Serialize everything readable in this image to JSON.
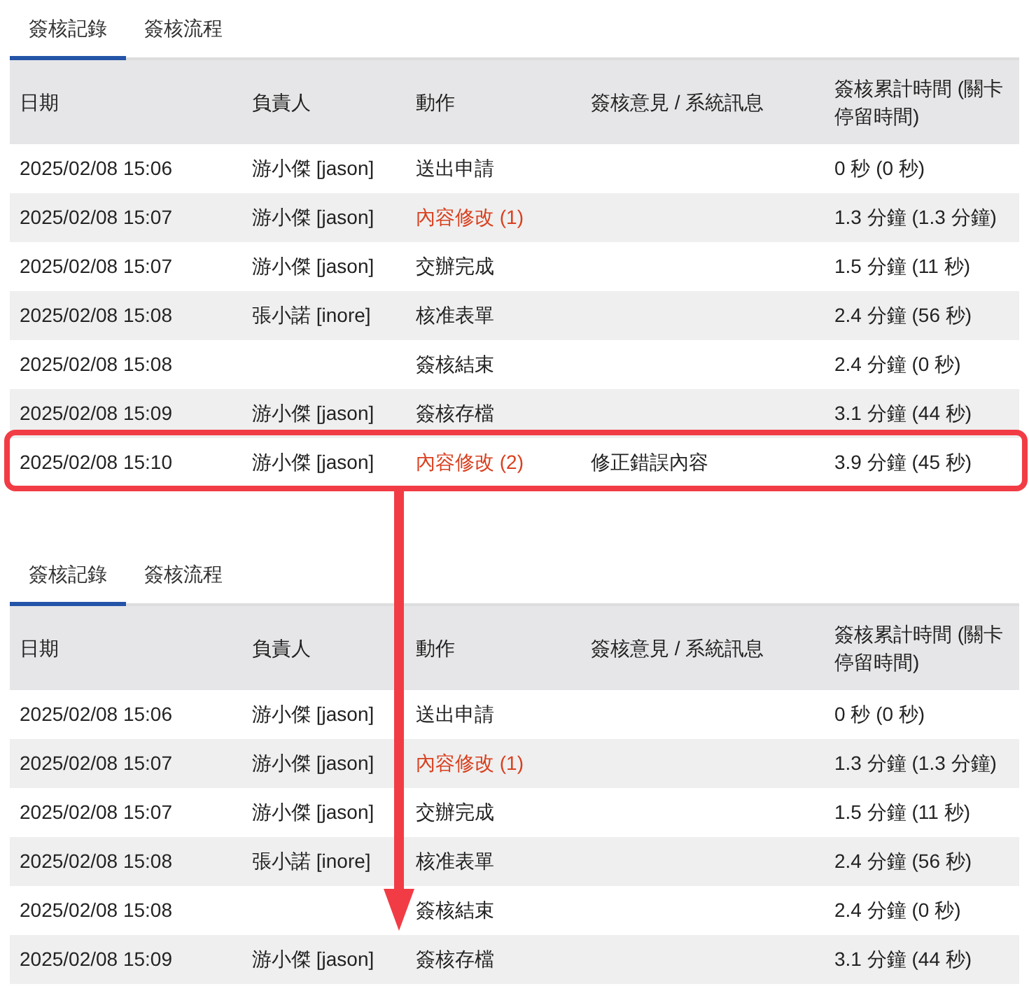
{
  "panels": [
    {
      "tabs": [
        {
          "label": "簽核記錄",
          "selected": true
        },
        {
          "label": "簽核流程",
          "selected": false
        }
      ],
      "columns": [
        "日期",
        "負責人",
        "動作",
        "簽核意見 / 系統訊息",
        "簽核累計時間 (關卡停留時間)"
      ],
      "rows": [
        {
          "date": "2025/02/08 15:06",
          "person": "游小傑 [jason]",
          "action": "送出申請",
          "kind": "normal",
          "comment": "",
          "duration": "0 秒 (0 秒)",
          "highlighted": false
        },
        {
          "date": "2025/02/08 15:07",
          "person": "游小傑 [jason]",
          "action": "內容修改 (1)",
          "kind": "edit",
          "comment": "",
          "duration": "1.3 分鐘 (1.3 分鐘)",
          "highlighted": false
        },
        {
          "date": "2025/02/08 15:07",
          "person": "游小傑 [jason]",
          "action": "交辦完成",
          "kind": "normal",
          "comment": "",
          "duration": "1.5 分鐘 (11 秒)",
          "highlighted": false
        },
        {
          "date": "2025/02/08 15:08",
          "person": "張小諾 [inore]",
          "action": "核准表單",
          "kind": "normal",
          "comment": "",
          "duration": "2.4 分鐘 (56 秒)",
          "highlighted": false
        },
        {
          "date": "2025/02/08 15:08",
          "person": "",
          "action": "簽核結束",
          "kind": "normal",
          "comment": "",
          "duration": "2.4 分鐘 (0 秒)",
          "highlighted": false
        },
        {
          "date": "2025/02/08 15:09",
          "person": "游小傑 [jason]",
          "action": "簽核存檔",
          "kind": "normal",
          "comment": "",
          "duration": "3.1 分鐘 (44 秒)",
          "highlighted": false
        },
        {
          "date": "2025/02/08 15:10",
          "person": "游小傑 [jason]",
          "action": "內容修改 (2)",
          "kind": "edit",
          "comment": "修正錯誤內容",
          "duration": "3.9 分鐘 (45 秒)",
          "highlighted": true
        }
      ]
    },
    {
      "tabs": [
        {
          "label": "簽核記錄",
          "selected": true
        },
        {
          "label": "簽核流程",
          "selected": false
        }
      ],
      "columns": [
        "日期",
        "負責人",
        "動作",
        "簽核意見 / 系統訊息",
        "簽核累計時間 (關卡停留時間)"
      ],
      "rows": [
        {
          "date": "2025/02/08 15:06",
          "person": "游小傑 [jason]",
          "action": "送出申請",
          "kind": "normal",
          "comment": "",
          "duration": "0 秒 (0 秒)",
          "highlighted": false
        },
        {
          "date": "2025/02/08 15:07",
          "person": "游小傑 [jason]",
          "action": "內容修改 (1)",
          "kind": "edit",
          "comment": "",
          "duration": "1.3 分鐘 (1.3 分鐘)",
          "highlighted": false
        },
        {
          "date": "2025/02/08 15:07",
          "person": "游小傑 [jason]",
          "action": "交辦完成",
          "kind": "normal",
          "comment": "",
          "duration": "1.5 分鐘 (11 秒)",
          "highlighted": false
        },
        {
          "date": "2025/02/08 15:08",
          "person": "張小諾 [inore]",
          "action": "核准表單",
          "kind": "normal",
          "comment": "",
          "duration": "2.4 分鐘 (56 秒)",
          "highlighted": false
        },
        {
          "date": "2025/02/08 15:08",
          "person": "",
          "action": "簽核結束",
          "kind": "normal",
          "comment": "",
          "duration": "2.4 分鐘 (0 秒)",
          "highlighted": false
        },
        {
          "date": "2025/02/08 15:09",
          "person": "游小傑 [jason]",
          "action": "簽核存檔",
          "kind": "normal",
          "comment": "",
          "duration": "3.1 分鐘 (44 秒)",
          "highlighted": false
        }
      ]
    }
  ]
}
